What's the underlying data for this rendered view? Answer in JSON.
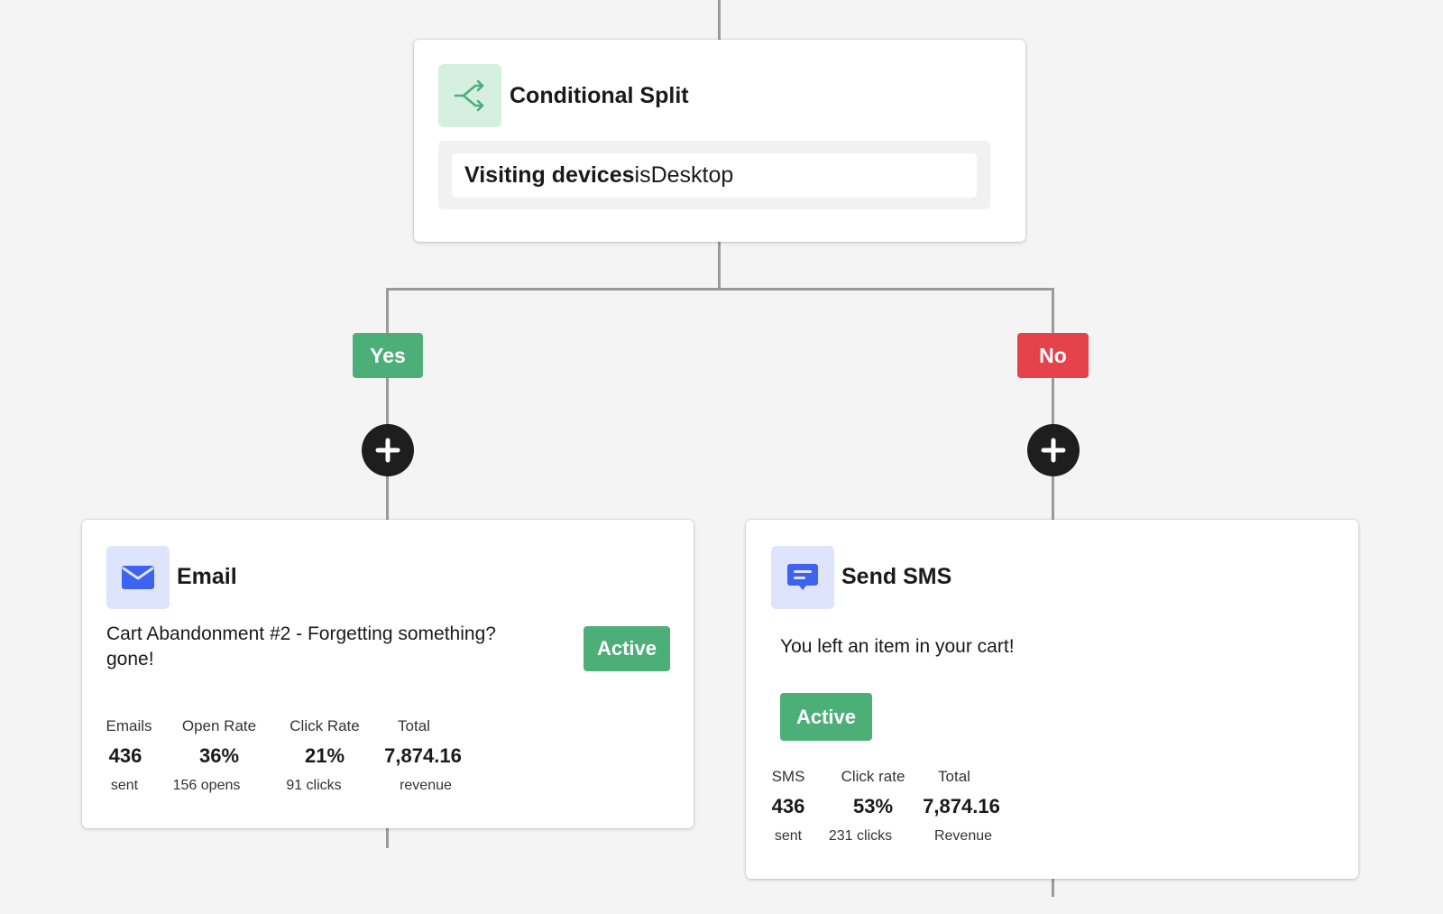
{
  "conditional_split": {
    "title": "Conditional Split",
    "condition": {
      "field": "Visiting devices",
      "operator": "is",
      "value": "Desktop"
    },
    "icon": "split-arrows-icon",
    "icon_color": "#4caf78",
    "icon_bg": "#d5efe1"
  },
  "branches": {
    "yes": {
      "label": "Yes",
      "color": "#4caf78"
    },
    "no": {
      "label": "No",
      "color": "#e5434b"
    }
  },
  "add_step_icon": "plus-icon",
  "email_card": {
    "title": "Email",
    "icon": "envelope-icon",
    "icon_bg": "#dde4fb",
    "icon_color": "#3d63f0",
    "message_line1": "Cart Abandonment #2 - Forgetting something?",
    "message_line2": "gone!",
    "status": "Active",
    "stats": [
      {
        "label": "Emails",
        "value": "436",
        "sub": "sent"
      },
      {
        "label": "Open Rate",
        "value": "36%",
        "sub": "156 opens"
      },
      {
        "label": "Click Rate",
        "value": "21%",
        "sub": "91 clicks"
      },
      {
        "label": "Total",
        "value": "7,874.16",
        "sub": "revenue"
      }
    ]
  },
  "sms_card": {
    "title": "Send SMS",
    "icon": "chat-bubble-icon",
    "icon_bg": "#dde4fb",
    "icon_color": "#3d63f0",
    "message": "You left an item in your cart!",
    "status": "Active",
    "stats": [
      {
        "label": "SMS",
        "value": "436",
        "sub": "sent"
      },
      {
        "label": "Click rate",
        "value": "53%",
        "sub": "231 clicks"
      },
      {
        "label": "Total",
        "value": "7,874.16",
        "sub": "Revenue"
      }
    ]
  }
}
